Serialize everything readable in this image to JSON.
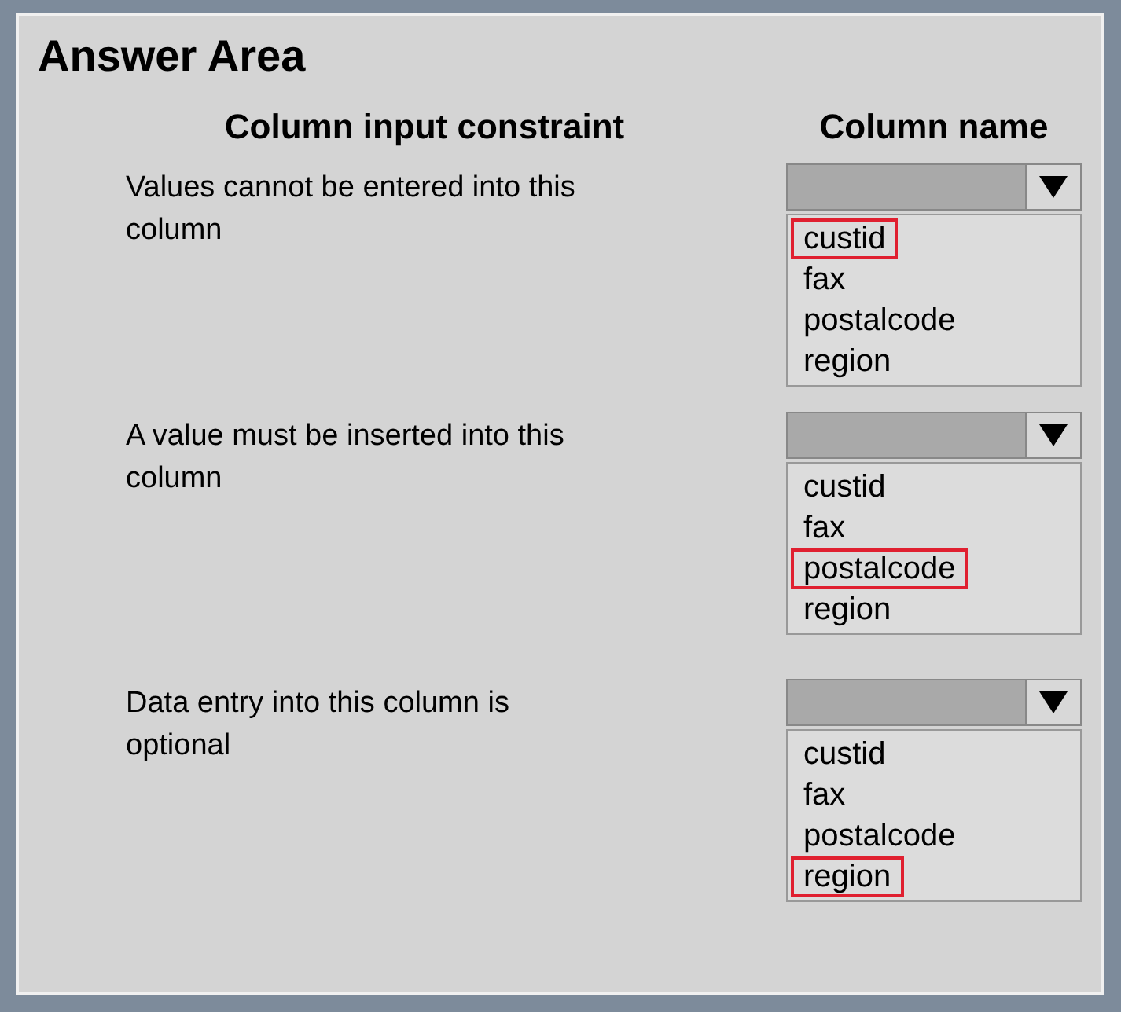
{
  "title": "Answer Area",
  "columns": [
    "Column input constraint",
    "Column name"
  ],
  "rows": [
    {
      "constraint": "Values cannot be entered into this column",
      "options": [
        {
          "label": "custid",
          "selected": true
        },
        {
          "label": "fax",
          "selected": false
        },
        {
          "label": "postalcode",
          "selected": false
        },
        {
          "label": "region",
          "selected": false
        }
      ]
    },
    {
      "constraint": "A value must be inserted into this column",
      "options": [
        {
          "label": "custid",
          "selected": false
        },
        {
          "label": "fax",
          "selected": false
        },
        {
          "label": "postalcode",
          "selected": true
        },
        {
          "label": "region",
          "selected": false
        }
      ]
    },
    {
      "constraint": "Data entry into this column is optional",
      "options": [
        {
          "label": "custid",
          "selected": false
        },
        {
          "label": "fax",
          "selected": false
        },
        {
          "label": "postalcode",
          "selected": false
        },
        {
          "label": "region",
          "selected": true
        }
      ]
    }
  ]
}
